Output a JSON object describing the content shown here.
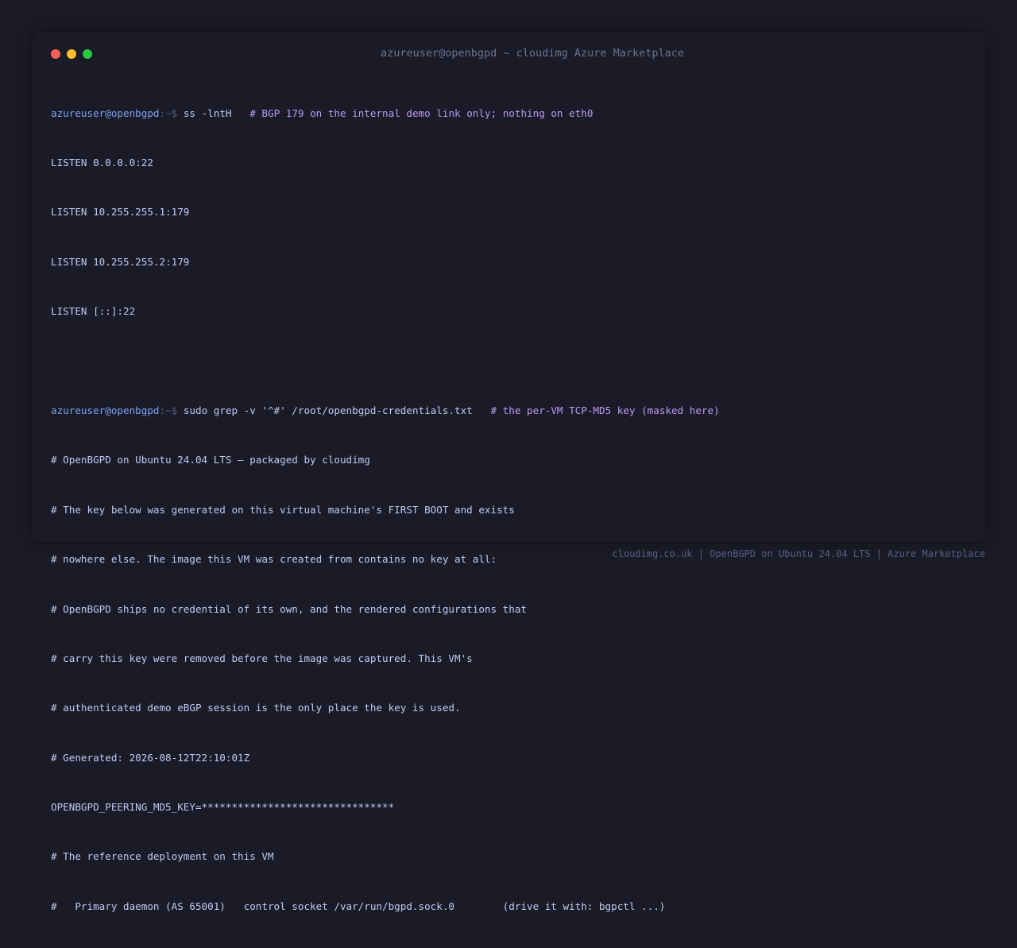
{
  "window": {
    "title": "azureuser@openbgpd ~ cloudimg Azure Marketplace",
    "traffic_light_colors": {
      "close": "#ff5f57",
      "minimize": "#febc2e",
      "maximize": "#28c840"
    }
  },
  "terminal": {
    "prompt_user": "azureuser@openbgpd",
    "prompt_sep": ":~$",
    "commands": [
      {
        "cmd": "ss -lntH",
        "comment": "# BGP 179 on the internal demo link only; nothing on eth0"
      },
      {
        "cmd": "sudo grep -v '^#' /root/openbgpd-credentials.txt",
        "comment": "# the per-VM TCP-MD5 key (masked here)"
      }
    ],
    "outputs": [
      [
        "LISTEN 0.0.0.0:22",
        "LISTEN 10.255.255.1:179",
        "LISTEN 10.255.255.2:179",
        "LISTEN [::]:22"
      ],
      [
        "# OpenBGPD on Ubuntu 24.04 LTS — packaged by cloudimg",
        "# The key below was generated on this virtual machine's FIRST BOOT and exists",
        "# nowhere else. The image this VM was created from contains no key at all:",
        "# OpenBGPD ships no credential of its own, and the rendered configurations that",
        "# carry this key were removed before the image was captured. This VM's",
        "# authenticated demo eBGP session is the only place the key is used.",
        "# Generated: 2026-08-12T22:10:01Z",
        "OPENBGPD_PEERING_MD5_KEY=********************************",
        "# The reference deployment on this VM",
        "#   Primary daemon (AS 65001)   control socket /var/run/bgpd.sock.0        (drive it with: bgpctl ...)"
      ]
    ]
  },
  "footer": {
    "text": "cloudimg.co.uk | OpenBGPD on Ubuntu 24.04 LTS | Azure Marketplace"
  },
  "colors": {
    "background": "#1a1b26",
    "prompt_user": "#7aa2f7",
    "prompt_sep": "#565f89",
    "command": "#c0caf5",
    "comment": "#bb9af7",
    "output": "#c0caf5",
    "title": "#6b7394"
  }
}
